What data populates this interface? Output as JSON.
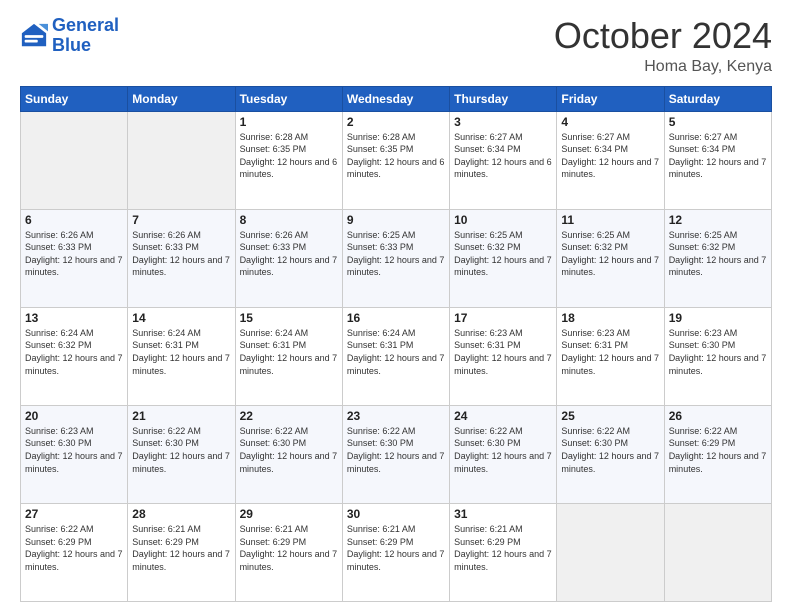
{
  "logo": {
    "line1": "General",
    "line2": "Blue"
  },
  "title": "October 2024",
  "location": "Homa Bay, Kenya",
  "days_header": [
    "Sunday",
    "Monday",
    "Tuesday",
    "Wednesday",
    "Thursday",
    "Friday",
    "Saturday"
  ],
  "weeks": [
    [
      {
        "day": "",
        "info": ""
      },
      {
        "day": "",
        "info": ""
      },
      {
        "day": "1",
        "info": "Sunrise: 6:28 AM\nSunset: 6:35 PM\nDaylight: 12 hours and 6 minutes."
      },
      {
        "day": "2",
        "info": "Sunrise: 6:28 AM\nSunset: 6:35 PM\nDaylight: 12 hours and 6 minutes."
      },
      {
        "day": "3",
        "info": "Sunrise: 6:27 AM\nSunset: 6:34 PM\nDaylight: 12 hours and 6 minutes."
      },
      {
        "day": "4",
        "info": "Sunrise: 6:27 AM\nSunset: 6:34 PM\nDaylight: 12 hours and 7 minutes."
      },
      {
        "day": "5",
        "info": "Sunrise: 6:27 AM\nSunset: 6:34 PM\nDaylight: 12 hours and 7 minutes."
      }
    ],
    [
      {
        "day": "6",
        "info": "Sunrise: 6:26 AM\nSunset: 6:33 PM\nDaylight: 12 hours and 7 minutes."
      },
      {
        "day": "7",
        "info": "Sunrise: 6:26 AM\nSunset: 6:33 PM\nDaylight: 12 hours and 7 minutes."
      },
      {
        "day": "8",
        "info": "Sunrise: 6:26 AM\nSunset: 6:33 PM\nDaylight: 12 hours and 7 minutes."
      },
      {
        "day": "9",
        "info": "Sunrise: 6:25 AM\nSunset: 6:33 PM\nDaylight: 12 hours and 7 minutes."
      },
      {
        "day": "10",
        "info": "Sunrise: 6:25 AM\nSunset: 6:32 PM\nDaylight: 12 hours and 7 minutes."
      },
      {
        "day": "11",
        "info": "Sunrise: 6:25 AM\nSunset: 6:32 PM\nDaylight: 12 hours and 7 minutes."
      },
      {
        "day": "12",
        "info": "Sunrise: 6:25 AM\nSunset: 6:32 PM\nDaylight: 12 hours and 7 minutes."
      }
    ],
    [
      {
        "day": "13",
        "info": "Sunrise: 6:24 AM\nSunset: 6:32 PM\nDaylight: 12 hours and 7 minutes."
      },
      {
        "day": "14",
        "info": "Sunrise: 6:24 AM\nSunset: 6:31 PM\nDaylight: 12 hours and 7 minutes."
      },
      {
        "day": "15",
        "info": "Sunrise: 6:24 AM\nSunset: 6:31 PM\nDaylight: 12 hours and 7 minutes."
      },
      {
        "day": "16",
        "info": "Sunrise: 6:24 AM\nSunset: 6:31 PM\nDaylight: 12 hours and 7 minutes."
      },
      {
        "day": "17",
        "info": "Sunrise: 6:23 AM\nSunset: 6:31 PM\nDaylight: 12 hours and 7 minutes."
      },
      {
        "day": "18",
        "info": "Sunrise: 6:23 AM\nSunset: 6:31 PM\nDaylight: 12 hours and 7 minutes."
      },
      {
        "day": "19",
        "info": "Sunrise: 6:23 AM\nSunset: 6:30 PM\nDaylight: 12 hours and 7 minutes."
      }
    ],
    [
      {
        "day": "20",
        "info": "Sunrise: 6:23 AM\nSunset: 6:30 PM\nDaylight: 12 hours and 7 minutes."
      },
      {
        "day": "21",
        "info": "Sunrise: 6:22 AM\nSunset: 6:30 PM\nDaylight: 12 hours and 7 minutes."
      },
      {
        "day": "22",
        "info": "Sunrise: 6:22 AM\nSunset: 6:30 PM\nDaylight: 12 hours and 7 minutes."
      },
      {
        "day": "23",
        "info": "Sunrise: 6:22 AM\nSunset: 6:30 PM\nDaylight: 12 hours and 7 minutes."
      },
      {
        "day": "24",
        "info": "Sunrise: 6:22 AM\nSunset: 6:30 PM\nDaylight: 12 hours and 7 minutes."
      },
      {
        "day": "25",
        "info": "Sunrise: 6:22 AM\nSunset: 6:30 PM\nDaylight: 12 hours and 7 minutes."
      },
      {
        "day": "26",
        "info": "Sunrise: 6:22 AM\nSunset: 6:29 PM\nDaylight: 12 hours and 7 minutes."
      }
    ],
    [
      {
        "day": "27",
        "info": "Sunrise: 6:22 AM\nSunset: 6:29 PM\nDaylight: 12 hours and 7 minutes."
      },
      {
        "day": "28",
        "info": "Sunrise: 6:21 AM\nSunset: 6:29 PM\nDaylight: 12 hours and 7 minutes."
      },
      {
        "day": "29",
        "info": "Sunrise: 6:21 AM\nSunset: 6:29 PM\nDaylight: 12 hours and 7 minutes."
      },
      {
        "day": "30",
        "info": "Sunrise: 6:21 AM\nSunset: 6:29 PM\nDaylight: 12 hours and 7 minutes."
      },
      {
        "day": "31",
        "info": "Sunrise: 6:21 AM\nSunset: 6:29 PM\nDaylight: 12 hours and 7 minutes."
      },
      {
        "day": "",
        "info": ""
      },
      {
        "day": "",
        "info": ""
      }
    ]
  ]
}
